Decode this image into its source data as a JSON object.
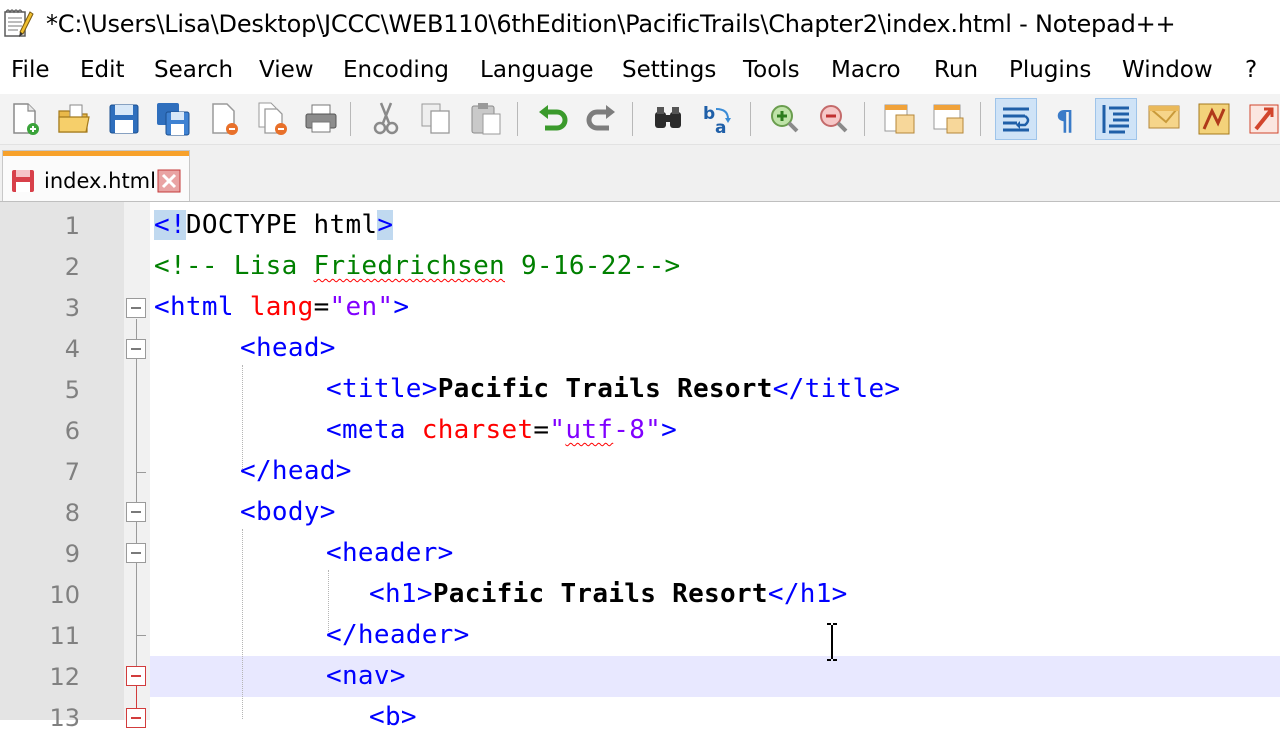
{
  "window": {
    "title": "*C:\\Users\\Lisa\\Desktop\\JCCC\\WEB110\\6thEdition\\PacificTrails\\Chapter2\\index.html - Notepad++",
    "app_icon": "notepad-icon"
  },
  "menu": [
    "File",
    "Edit",
    "Search",
    "View",
    "Encoding",
    "Language",
    "Settings",
    "Tools",
    "Macro",
    "Run",
    "Plugins",
    "Window",
    "?"
  ],
  "toolbar": {
    "buttons": [
      "new-file-icon",
      "open-file-icon",
      "save-icon",
      "save-all-icon",
      "close-icon",
      "close-all-icon",
      "print-icon",
      "cut-icon",
      "copy-icon",
      "paste-icon",
      "undo-icon",
      "redo-icon",
      "find-icon",
      "replace-icon",
      "zoom-in-icon",
      "zoom-out-icon",
      "sync-vertical-icon",
      "sync-horizontal-icon",
      "word-wrap-icon",
      "show-all-chars-icon",
      "indent-guide-icon",
      "document-map-icon",
      "function-list-icon",
      "folder-workspace-icon",
      "monitoring-icon"
    ]
  },
  "tab": {
    "label": "index.html",
    "close_icon": "close-tab-icon",
    "status_icon": "unsaved-file-icon"
  },
  "editor": {
    "lines": [
      {
        "n": "1",
        "parts": [
          {
            "t": "<!",
            "c": "tag hl"
          },
          {
            "t": "DOCTYPE html",
            "c": "doc"
          },
          {
            "t": ">",
            "c": "tag hl"
          }
        ]
      },
      {
        "n": "2",
        "parts": [
          {
            "t": "<!-- Lisa ",
            "c": "cmt"
          },
          {
            "t": "Friedrichsen",
            "c": "cmt squiggle"
          },
          {
            "t": " 9-16-22-->",
            "c": "cmt"
          }
        ]
      },
      {
        "n": "3",
        "parts": [
          {
            "t": "<html ",
            "c": "tag"
          },
          {
            "t": "lang",
            "c": "attr"
          },
          {
            "t": "=",
            "c": "eq"
          },
          {
            "t": "\"en\"",
            "c": "val"
          },
          {
            "t": ">",
            "c": "tag"
          }
        ]
      },
      {
        "n": "4",
        "parts": [
          {
            "t": "<head>",
            "c": "tag"
          }
        ]
      },
      {
        "n": "5",
        "parts": [
          {
            "t": "<title>",
            "c": "tag"
          },
          {
            "t": "Pacific Trails Resort",
            "c": "txt"
          },
          {
            "t": "</title>",
            "c": "tag"
          }
        ]
      },
      {
        "n": "6",
        "parts": [
          {
            "t": "<meta ",
            "c": "tag"
          },
          {
            "t": "charset",
            "c": "attr"
          },
          {
            "t": "=",
            "c": "eq"
          },
          {
            "t": "\"",
            "c": "val"
          },
          {
            "t": "utf",
            "c": "val squiggle"
          },
          {
            "t": "-8\"",
            "c": "val"
          },
          {
            "t": ">",
            "c": "tag"
          }
        ]
      },
      {
        "n": "7",
        "parts": [
          {
            "t": "</head>",
            "c": "tag"
          }
        ]
      },
      {
        "n": "8",
        "parts": [
          {
            "t": "<body>",
            "c": "tag"
          }
        ]
      },
      {
        "n": "9",
        "parts": [
          {
            "t": "<header>",
            "c": "tag"
          }
        ]
      },
      {
        "n": "10",
        "parts": [
          {
            "t": "<h1>",
            "c": "tag"
          },
          {
            "t": "Pacific Trails Resort",
            "c": "txt"
          },
          {
            "t": "</h1>",
            "c": "tag"
          }
        ]
      },
      {
        "n": "11",
        "parts": [
          {
            "t": "</header>",
            "c": "tag"
          }
        ]
      },
      {
        "n": "12",
        "parts": [
          {
            "t": "<nav>",
            "c": "tag"
          }
        ]
      },
      {
        "n": "13",
        "parts": [
          {
            "t": "<b>",
            "c": "tag"
          }
        ]
      }
    ]
  },
  "colors": {
    "tag": "#0000ff",
    "attribute": "#ff0000",
    "value": "#8000ff",
    "comment": "#008000",
    "current_line": "#e8e8ff",
    "tab_accent": "#f7a12b"
  }
}
